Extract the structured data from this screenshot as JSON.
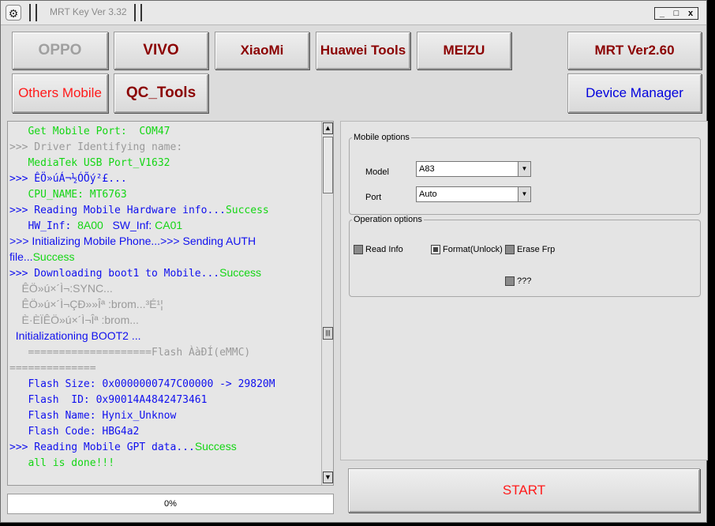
{
  "window": {
    "title": "MRT Key Ver 3.32",
    "controls": [
      "_",
      "□",
      "x"
    ]
  },
  "brands": {
    "oppo": "OPPO",
    "vivo": "VIVO",
    "xiaomi": "XiaoMi",
    "huawei": "Huawei Tools",
    "meizu": "MEIZU",
    "mrt": "MRT Ver2.60",
    "others": "Others Mobile",
    "qc": "QC_Tools",
    "device_manager": "Device Manager"
  },
  "colors": {
    "disabled": "#a0a0a0",
    "dark_red": "#8b0000",
    "red": "#ff1a1a",
    "blue": "#0000dd"
  },
  "log": [
    [
      {
        "t": "   Get Mobile Port:  COM47",
        "c": "green",
        "m": 1
      }
    ],
    [
      {
        "t": ">>> Driver Identifying name:",
        "c": "gray",
        "m": 1
      }
    ],
    [
      {
        "t": "   MediaTek USB Port_V1632",
        "c": "green",
        "m": 1
      }
    ],
    [
      {
        "t": ">>> ÊÖ»úÁ¬½ÓÕý²£...",
        "c": "blue",
        "m": 1
      }
    ],
    [
      {
        "t": "   CPU_NAME: MT6763",
        "c": "green",
        "m": 1
      }
    ],
    [
      {
        "t": ">>> Reading Mobile Hardware info...",
        "c": "blue",
        "m": 1
      },
      {
        "t": "Success",
        "c": "green",
        "m": 1
      }
    ],
    [
      {
        "t": "   HW_Inf: ",
        "c": "blue",
        "m": 1
      },
      {
        "t": "8A00",
        "c": "green",
        "m": 0
      },
      {
        "t": "   SW_Inf: ",
        "c": "blue",
        "m": 0
      },
      {
        "t": "CA01",
        "c": "green",
        "m": 0
      }
    ],
    [
      {
        "t": ">>> Initializing Mobile Phone...>>> Sending AUTH",
        "c": "blue",
        "m": 0
      }
    ],
    [
      {
        "t": "file...",
        "c": "blue",
        "m": 0
      },
      {
        "t": "Success",
        "c": "green",
        "m": 0
      }
    ],
    [
      {
        "t": ">>> Downloading boot1 to Mobile...",
        "c": "blue",
        "m": 1
      },
      {
        "t": "Success",
        "c": "green",
        "m": 0
      }
    ],
    [
      {
        "t": "    ÊÖ»ú×´Ì¬:SYNC...",
        "c": "gray",
        "m": 0
      }
    ],
    [
      {
        "t": "    ÊÖ»ú×´Ì¬ÇÐ»»Îª :brom...³É¹¦",
        "c": "gray",
        "m": 0
      }
    ],
    [
      {
        "t": "    È·ÈÏÊÖ»ú×´Ì¬Îª :brom...",
        "c": "gray",
        "m": 0
      }
    ],
    [
      {
        "t": "  Initializationing BOOT2 ...",
        "c": "blue",
        "m": 0
      }
    ],
    [
      {
        "t": "   ====================Flash ÀàÐÍ(eMMC)",
        "c": "gray",
        "m": 1
      }
    ],
    [
      {
        "t": "==============",
        "c": "gray",
        "m": 1
      }
    ],
    [
      {
        "t": "   Flash Size: 0x0000000747C00000 -> 29820M",
        "c": "blue",
        "m": 1
      }
    ],
    [
      {
        "t": "   Flash  ID: 0x90014A4842473461",
        "c": "blue",
        "m": 1
      }
    ],
    [
      {
        "t": "   Flash Name: Hynix_Unknow",
        "c": "blue",
        "m": 1
      }
    ],
    [
      {
        "t": "   Flash Code: HBG4a2",
        "c": "blue",
        "m": 1
      }
    ],
    [
      {
        "t": ">>> Reading Mobile GPT data...",
        "c": "blue",
        "m": 1
      },
      {
        "t": "Success",
        "c": "green",
        "m": 0
      }
    ],
    [
      {
        "t": "   all is done!!!",
        "c": "green",
        "m": 1
      }
    ]
  ],
  "progress": {
    "text": "0%",
    "value": 0
  },
  "mobile_options": {
    "legend": "Mobile options",
    "model_label": "Model",
    "model_value": "A83",
    "port_label": "Port",
    "port_value": "Auto"
  },
  "operation_options": {
    "legend": "Operation options",
    "read_info": "Read Info",
    "format_unlock": "Format(Unlock)",
    "erase_frp": "Erase Frp",
    "unknown": "???"
  },
  "start_button": "START"
}
